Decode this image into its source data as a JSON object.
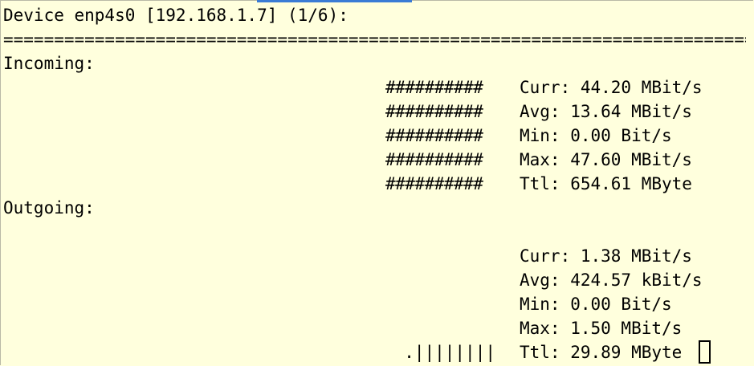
{
  "terminal": {
    "device_header": "Device enp4s0 [192.168.1.7] (1/6):",
    "separator": "=============================================================================",
    "incoming": {
      "label": "Incoming:",
      "graph_rows": [
        "##########",
        "##########",
        "##########",
        "##########",
        "##########"
      ],
      "curr": "Curr: 44.20 MBit/s",
      "avg": "Avg: 13.64 MBit/s",
      "min": "Min: 0.00 Bit/s",
      "max": "Max: 47.60 MBit/s",
      "ttl": "Ttl: 654.61 MByte"
    },
    "outgoing": {
      "label": "Outgoing:",
      "graph_last_row": ".||||||||",
      "curr": "Curr: 1.38 MBit/s",
      "avg": "Avg: 424.57 kBit/s",
      "min": "Min: 0.00 Bit/s",
      "max": "Max: 1.50 MBit/s",
      "ttl": "Ttl: 29.89 MByte"
    }
  },
  "colors": {
    "background": "#ffffdd",
    "text": "#000000",
    "tab_accent": "#3a7bd5"
  }
}
